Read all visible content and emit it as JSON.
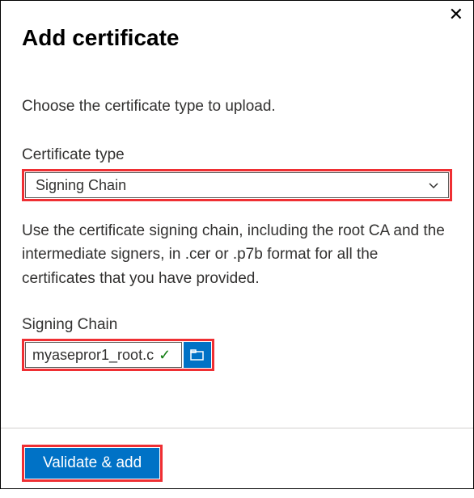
{
  "title": "Add certificate",
  "instruction": "Choose the certificate type to upload.",
  "certificate_type": {
    "label": "Certificate type",
    "selected": "Signing Chain"
  },
  "description": "Use the certificate signing chain, including the root CA and the intermediate signers, in .cer or .p7b format for all the certificates that you have provided.",
  "file_field": {
    "label": "Signing Chain",
    "value": "myasepror1_root.c"
  },
  "submit_label": "Validate & add",
  "colors": {
    "primary": "#0072c6",
    "highlight": "#ef2f33",
    "success": "#107c10"
  }
}
